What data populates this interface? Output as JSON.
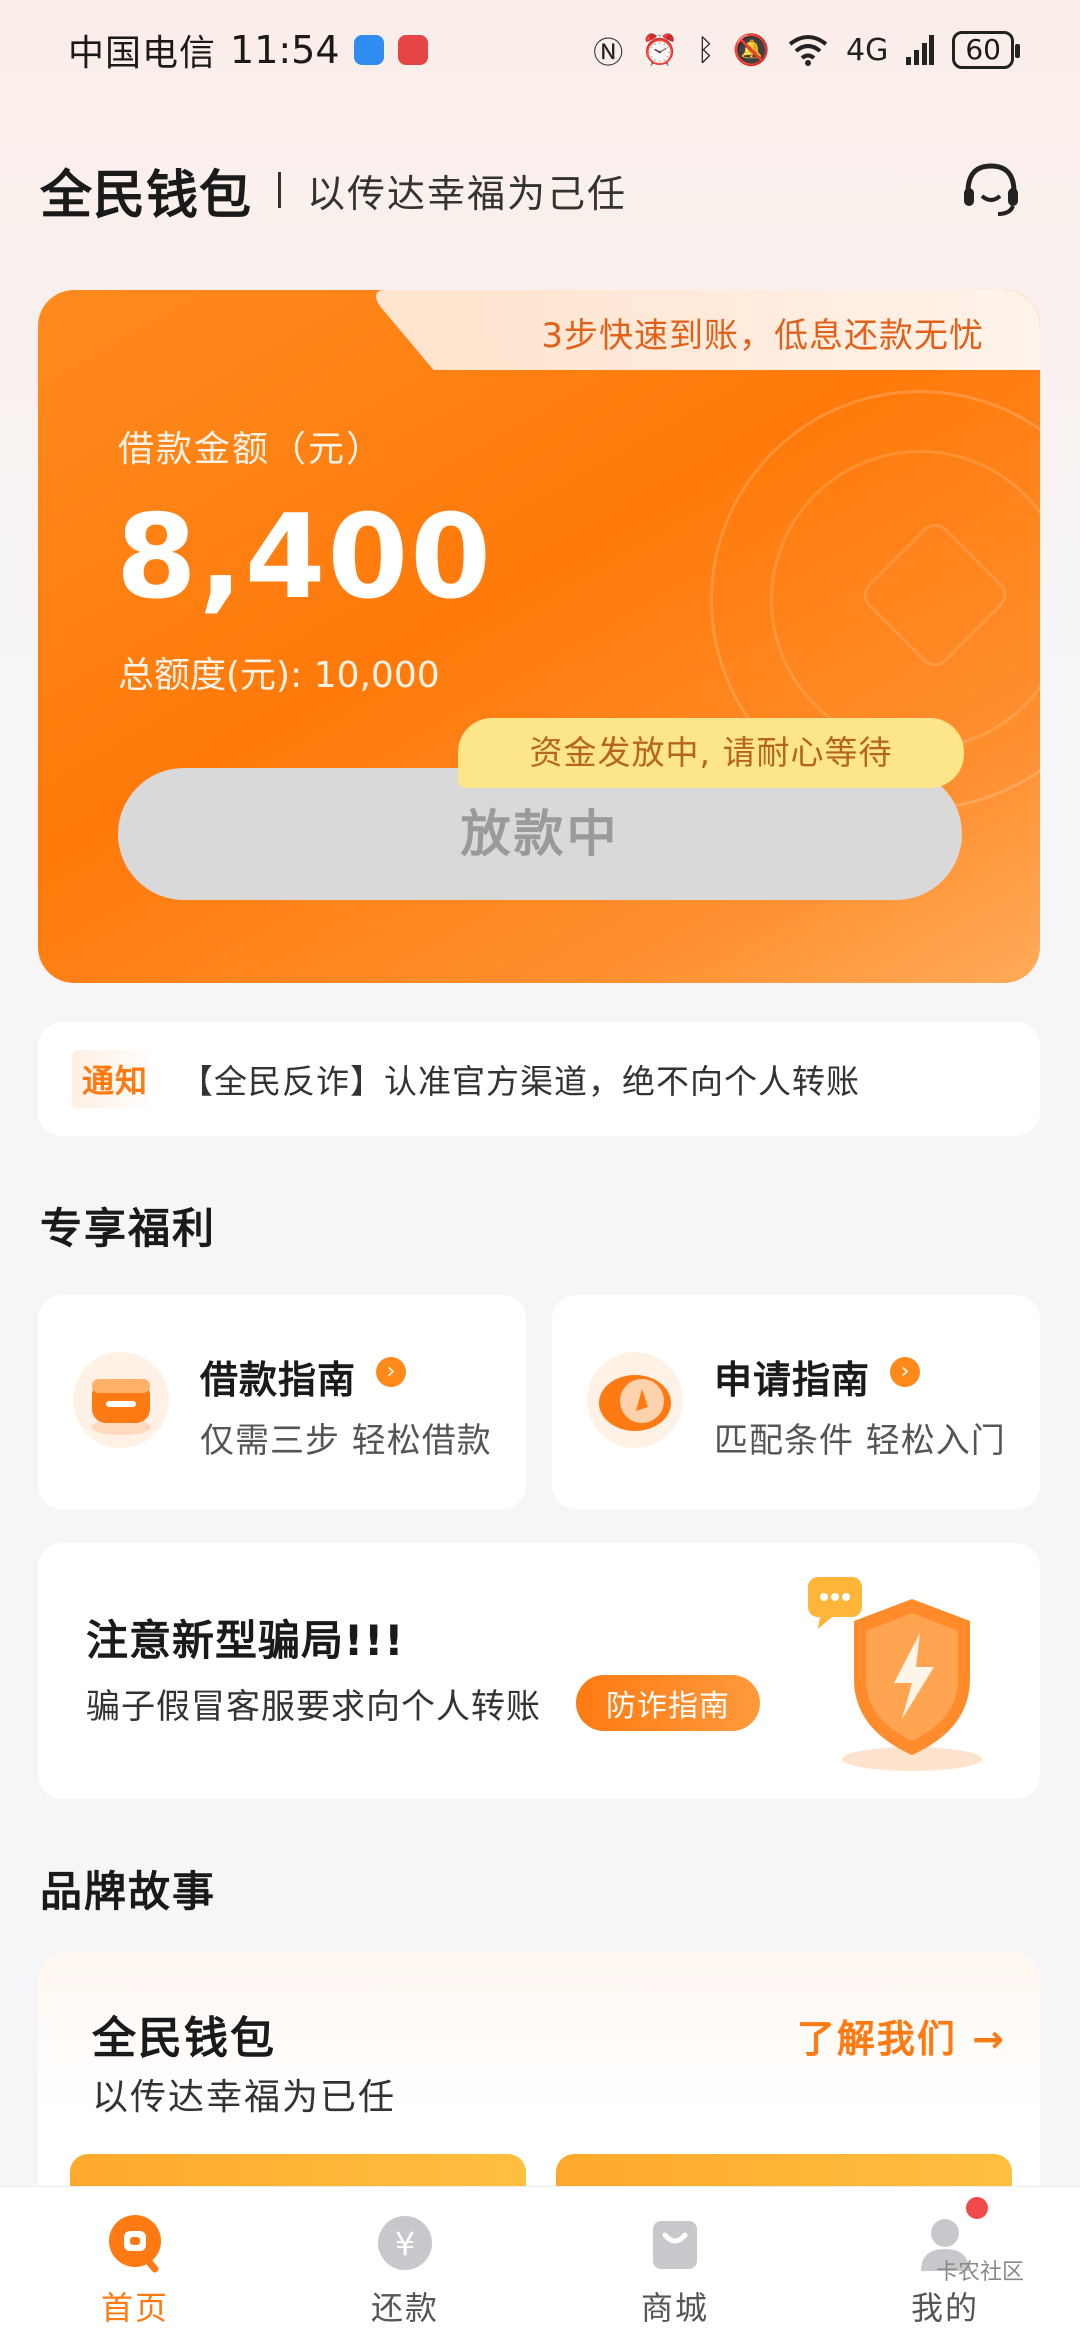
{
  "status_bar": {
    "carrier": "中国电信",
    "time": "11:54",
    "network": "4G",
    "battery": "60"
  },
  "header": {
    "title": "全民钱包",
    "slogan": "以传达幸福为己任",
    "support_icon": "headset-icon"
  },
  "loan_card": {
    "tab_text": "3步快速到账，低息还款无忧",
    "amount_label": "借款金额（元）",
    "amount": "8,400",
    "total_label": "总额度(元): 10,000",
    "release_tip": "资金发放中, 请耐心等待",
    "status_button": "放款中"
  },
  "notice": {
    "badge": "通知",
    "text": "【全民反诈】认准官方渠道，绝不向个人转账"
  },
  "benefits": {
    "title": "专享福利",
    "items": [
      {
        "title": "借款指南",
        "subtitle": "仅需三步 轻松借款",
        "icon": "wallet-icon"
      },
      {
        "title": "申请指南",
        "subtitle": "匹配条件 轻松入门",
        "icon": "compass-icon"
      }
    ]
  },
  "fraud": {
    "title": "注意新型骗局!!!",
    "subtitle": "骗子假冒客服要求向个人转账",
    "button": "防诈指南",
    "icon": "shield-lightning-icon"
  },
  "brand_story": {
    "section_title": "品牌故事",
    "title": "全民钱包",
    "subtitle": "以传达幸福为已任",
    "link": "了解我们 →"
  },
  "tabbar": {
    "items": [
      {
        "label": "首页",
        "icon": "home-icon",
        "active": true
      },
      {
        "label": "还款",
        "icon": "yuan-icon",
        "active": false
      },
      {
        "label": "商城",
        "icon": "shopping-bag-icon",
        "active": false
      },
      {
        "label": "我的",
        "icon": "user-icon",
        "active": false
      }
    ]
  },
  "watermark": "卡农社区",
  "colors": {
    "accent": "#ff7a12",
    "card_orange": "#ff7f12",
    "tip_yellow": "#fde68a",
    "button_gray": "#d9d9d9",
    "background": "#f6f6f8"
  }
}
